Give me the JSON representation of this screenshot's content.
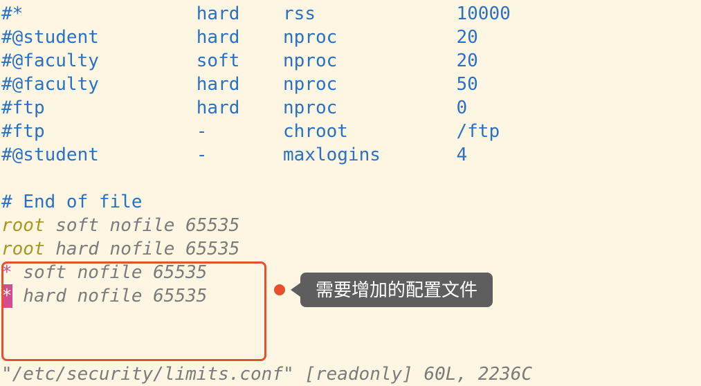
{
  "comment_rows": [
    {
      "c0": "#*",
      "c1": "hard",
      "c2": "rss",
      "c3": "10000"
    },
    {
      "c0": "#@student",
      "c1": "hard",
      "c2": "nproc",
      "c3": "20"
    },
    {
      "c0": "#@faculty",
      "c1": "soft",
      "c2": "nproc",
      "c3": "20"
    },
    {
      "c0": "#@faculty",
      "c1": "hard",
      "c2": "nproc",
      "c3": "50"
    },
    {
      "c0": "#ftp",
      "c1": "hard",
      "c2": "nproc",
      "c3": "0"
    },
    {
      "c0": "#ftp",
      "c1": "-",
      "c2": "chroot",
      "c3": "/ftp"
    },
    {
      "c0": "#@student",
      "c1": "-",
      "c2": "maxlogins",
      "c3": "4"
    }
  ],
  "end_comment": "# End of file",
  "config_rows": [
    {
      "user_class": "olive",
      "user": "root",
      "rest": " soft nofile 65535"
    },
    {
      "user_class": "olive",
      "user": "root",
      "rest": " hard nofile 65535"
    },
    {
      "user_class": "pink",
      "user": "*",
      "rest": " soft nofile 65535"
    },
    {
      "user_class": "pink",
      "user": "*",
      "rest": " hard nofile 65535",
      "cursor": true
    }
  ],
  "callout_text": "需要增加的配置文件",
  "status_line": "\"/etc/security/limits.conf\" [readonly] 60L, 2236C"
}
